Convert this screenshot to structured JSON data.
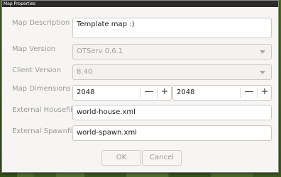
{
  "window": {
    "title": "Map Properties"
  },
  "form": {
    "description": {
      "label": "Map Description",
      "value": "Template map :)"
    },
    "map_version": {
      "label": "Map Version",
      "value": "OTServ 0.6.1"
    },
    "client_version": {
      "label": "Client Version",
      "value": "8.40"
    },
    "dimensions": {
      "label": "Map Dimensions",
      "width": "2048",
      "height": "2048",
      "minus": "—",
      "plus": "+"
    },
    "housefile": {
      "label": "External Housefile",
      "value": "world-house.xml"
    },
    "spawnfile": {
      "label": "External Spawnfile",
      "value": "world-spawn.xml"
    }
  },
  "buttons": {
    "ok": "OK",
    "cancel": "Cancel"
  }
}
